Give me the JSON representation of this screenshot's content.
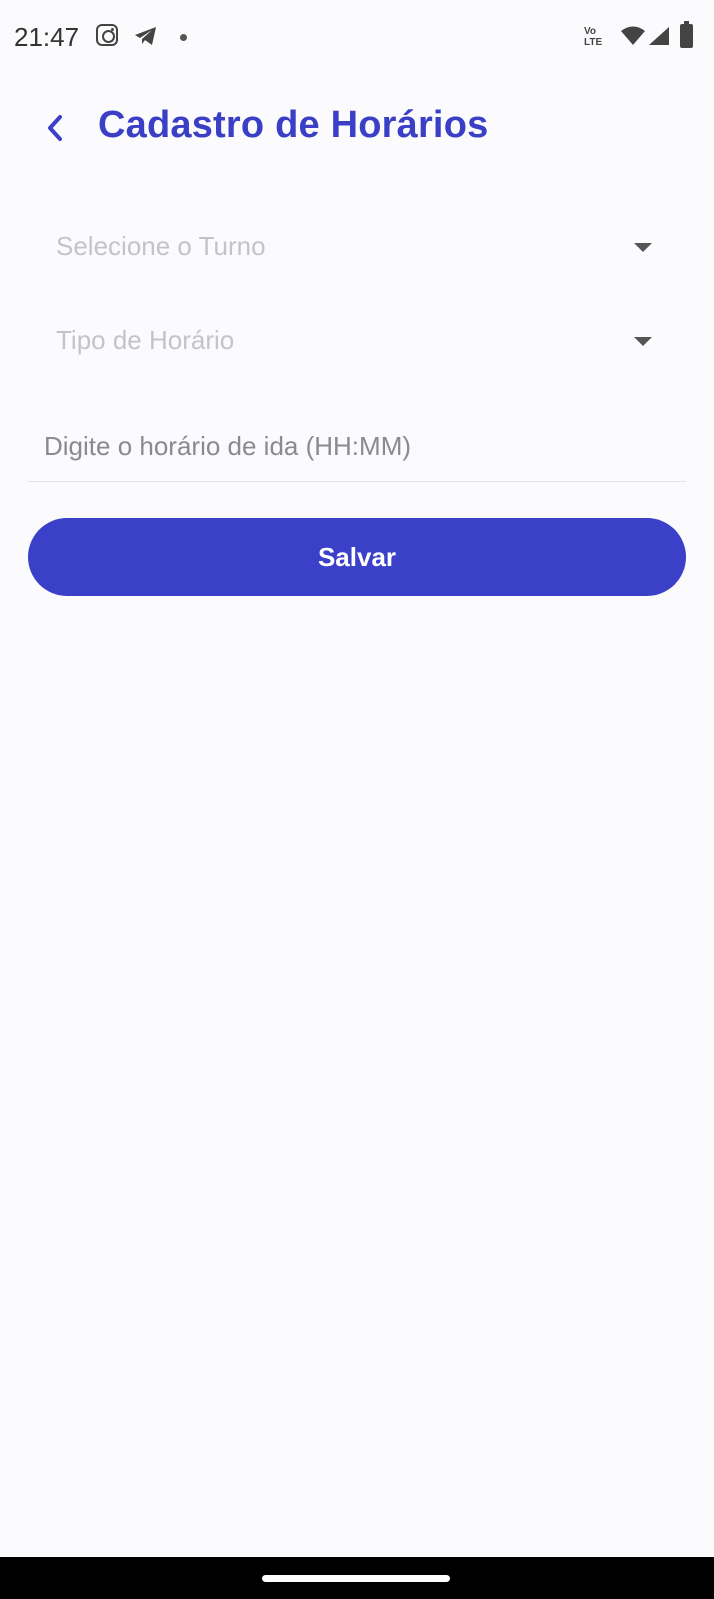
{
  "status_bar": {
    "time": "21:47",
    "network_label_top": "Vo",
    "network_label_bottom": "LTE",
    "icons": [
      "instagram-icon",
      "telegram-icon",
      "dot-icon",
      "wifi-icon",
      "signal-icon",
      "battery-icon"
    ]
  },
  "header": {
    "title": "Cadastro de Horários",
    "back_icon": "chevron-left-icon"
  },
  "form": {
    "turno_dropdown": {
      "placeholder": "Selecione o Turno"
    },
    "tipo_dropdown": {
      "placeholder": "Tipo de Horário"
    },
    "time_input": {
      "value": "",
      "placeholder": "Digite o horário de ida (HH:MM)"
    },
    "save_label": "Salvar"
  },
  "colors": {
    "accent": "#3b40c8",
    "background": "#fbfbfd",
    "placeholder": "#c3c3cb"
  }
}
